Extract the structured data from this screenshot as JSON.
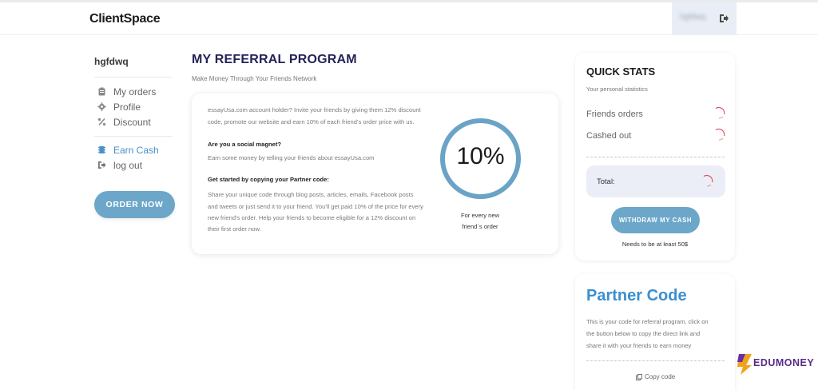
{
  "app": {
    "title": "ClientSpace",
    "user": "hgfdwq"
  },
  "sidebar": {
    "username": "hgfdwq",
    "items": [
      {
        "label": "My orders",
        "icon": "clipboard-icon"
      },
      {
        "label": "Profile",
        "icon": "gear-icon"
      },
      {
        "label": "Discount",
        "icon": "percent-icon"
      },
      {
        "label": "Earn Cash",
        "icon": "coins-icon",
        "active": true
      },
      {
        "label": "log out",
        "icon": "logout-icon"
      }
    ],
    "order_button": "ORDER NOW"
  },
  "main": {
    "title": "MY REFERRAL PROGRAM",
    "subtitle": "Make Money Through Your Friends Network",
    "intro_1": "essayUsa.com account holder? Invite your friends by giving them 12% discount",
    "intro_2": "code, promote our website and earn 10% of each friend's order price with us.",
    "heading_social": "Are you a social magnet?",
    "social_text": "Earn some money by telling your friends about essayUsa.com",
    "heading_partner": "Get started by copying your Partner code:",
    "partner_1": "Share your unique code through blog posts, articles, emails, Facebook posts",
    "partner_2": "and tweets or just send it to your friend. You'll get paid 10% of the price for every",
    "partner_3": "new friend's order. Help your friends to become eligible for a 12% discount on",
    "partner_4": "their first order now.",
    "percent": "10%",
    "caption_1": "For every new",
    "caption_2": "friend`s order"
  },
  "stats": {
    "title": "QUICK STATS",
    "subtitle": "Your personal statistics",
    "friends_orders": "Friends orders",
    "cashed_out": "Cashed out",
    "total": "Total:",
    "withdraw_button": "WITHDRAW MY CASH",
    "withdraw_note": "Needs to be at least 50$"
  },
  "partner": {
    "title": "Partner Code",
    "desc_1": "This is your code for referral program, click on",
    "desc_2": "the button below to copy the direct link and",
    "desc_3": "share it with your friends to earn money",
    "copy": "Copy code"
  },
  "watermark": {
    "text": "EDUMONEY"
  },
  "colors": {
    "accent": "#6ca7c9",
    "title": "#24225a",
    "partner": "#3a8fd0"
  }
}
